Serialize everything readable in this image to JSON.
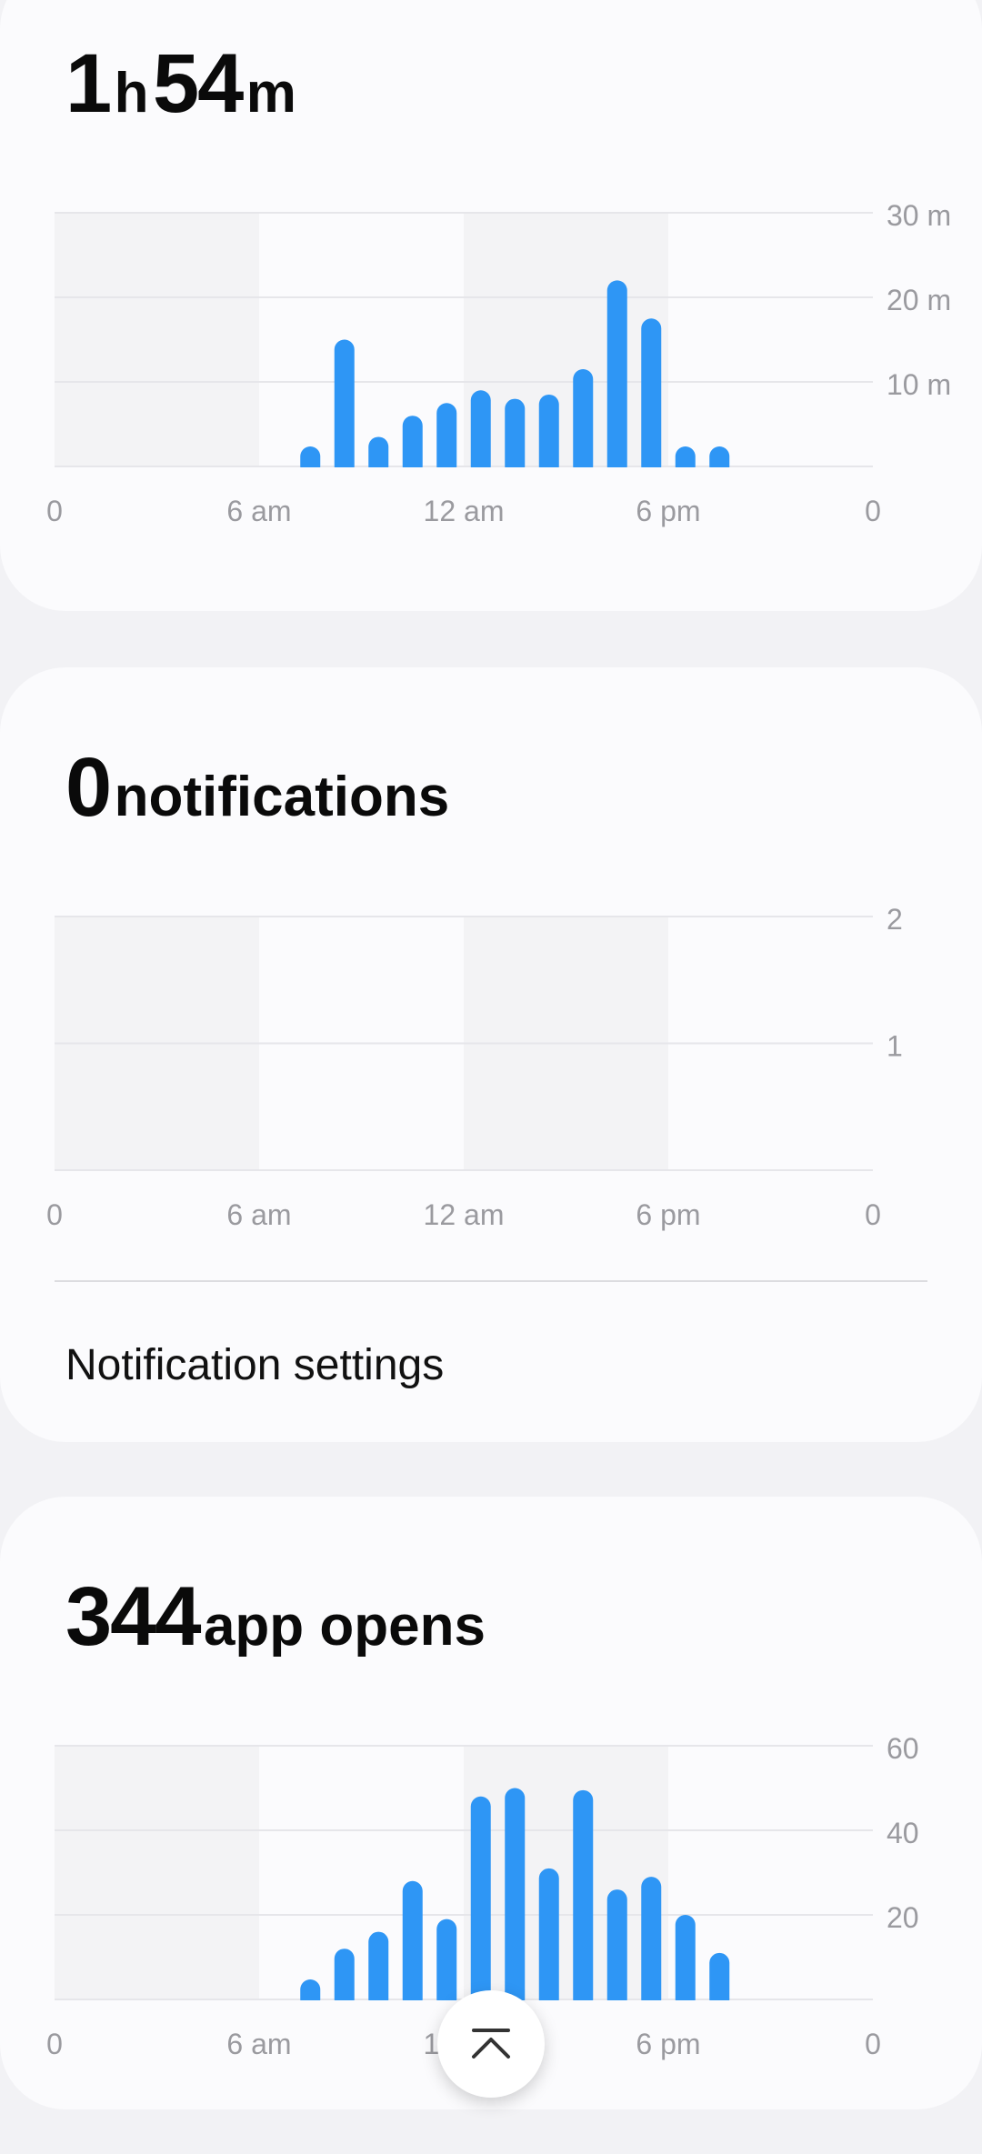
{
  "screen_time": {
    "hours_value": "1",
    "hours_unit": "h",
    "minutes_value": "54",
    "minutes_unit": "m"
  },
  "notifications": {
    "count": "0",
    "label": "notifications",
    "settings_label": "Notification settings"
  },
  "app_opens": {
    "count": "344",
    "label": "app opens"
  },
  "scroll_to_top_icon": "chevron-up-to-top-icon",
  "colors": {
    "bar": "#2e96f5",
    "shade": "#f3f3f5",
    "grid": "#e6e6ea",
    "tick_text": "#9a9a9f"
  },
  "chart_data": [
    {
      "type": "bar",
      "title": "",
      "x_ticks": [
        "0",
        "6 am",
        "12 am",
        "6 pm",
        "0"
      ],
      "y_ticks": [
        "30 m",
        "20 m",
        "10 m"
      ],
      "ylim": [
        0,
        30
      ],
      "hours": [
        7,
        8,
        9,
        10,
        11,
        12,
        13,
        14,
        15,
        16,
        17,
        18,
        19
      ],
      "values": [
        2,
        15,
        3.5,
        6,
        7.5,
        9,
        8,
        8.5,
        11.5,
        22,
        17.5,
        0.8,
        0.8
      ]
    },
    {
      "type": "bar",
      "title": "",
      "x_ticks": [
        "0",
        "6 am",
        "12 am",
        "6 pm",
        "0"
      ],
      "y_ticks": [
        "2",
        "1"
      ],
      "ylim": [
        0,
        2
      ],
      "hours": [],
      "values": []
    },
    {
      "type": "bar",
      "title": "",
      "x_ticks": [
        "0",
        "6 am",
        "12 am",
        "6 pm",
        "0"
      ],
      "y_ticks": [
        "60",
        "40",
        "20"
      ],
      "ylim": [
        0,
        60
      ],
      "hours": [
        7,
        8,
        9,
        10,
        11,
        12,
        13,
        14,
        15,
        16,
        17,
        18,
        19
      ],
      "values": [
        2.5,
        12,
        16,
        28,
        19,
        48,
        50,
        31,
        49.5,
        26,
        29,
        20,
        11
      ]
    }
  ]
}
